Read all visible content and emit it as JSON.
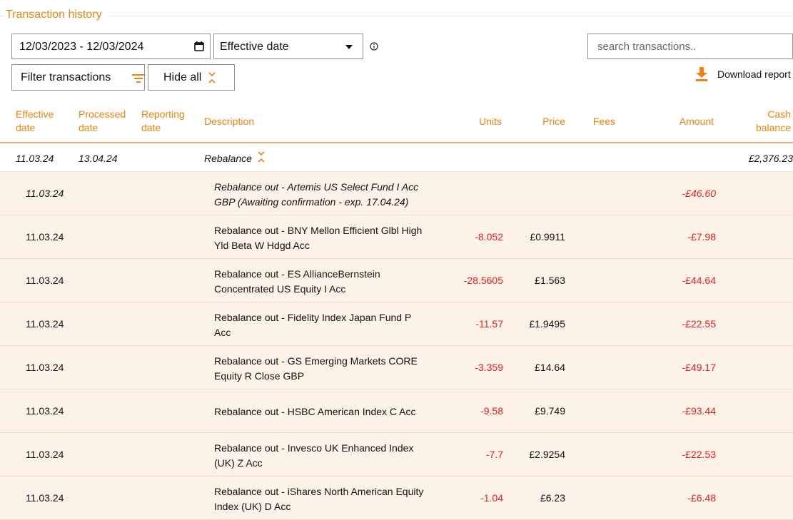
{
  "section": {
    "title": "Transaction history"
  },
  "filters": {
    "date_range": "12/03/2023 - 12/03/2024",
    "date_type": "Effective date",
    "search_placeholder": "search transactions..",
    "filter_label": "Filter transactions",
    "hide_label": "Hide all",
    "download_label": "Download report"
  },
  "colors": {
    "accent": "#f0820f",
    "negative": "#ee1c1c",
    "row_background": "#fdf2e8"
  },
  "icons": {
    "calendar": "calendar-icon",
    "dropdown": "caret-down-icon",
    "info": "info-icon",
    "filter": "filter-icon",
    "collapse": "chevrons-collapse-icon",
    "download": "download-icon"
  },
  "table": {
    "headers": {
      "effective_date": "Effective date",
      "processed_date": "Processed date",
      "reporting_date": "Reporting date",
      "description": "Description",
      "units": "Units",
      "price": "Price",
      "fees": "Fees",
      "amount": "Amount",
      "cash_balance": "Cash balance"
    },
    "group": {
      "effective_date": "11.03.24",
      "processed_date": "13.04.24",
      "description": "Rebalance",
      "cash_balance": "£2,376.23"
    },
    "rows": [
      {
        "effective_date": "11.03.24",
        "description": "Rebalance out - Artemis US Select Fund I Acc GBP (Awaiting confirmation - exp. 17.04.24)",
        "units": "",
        "price": "",
        "amount": "-£46.60",
        "pending": true
      },
      {
        "effective_date": "11.03.24",
        "description": "Rebalance out - BNY Mellon Efficient Glbl High Yld Beta W Hdgd Acc",
        "units": "-8.052",
        "price": "£0.9911",
        "amount": "-£7.98",
        "pending": false
      },
      {
        "effective_date": "11.03.24",
        "description": "Rebalance out - ES AllianceBernstein Concentrated US Equity I Acc",
        "units": "-28.5605",
        "price": "£1.563",
        "amount": "-£44.64",
        "pending": false
      },
      {
        "effective_date": "11.03.24",
        "description": "Rebalance out - Fidelity Index Japan Fund P Acc",
        "units": "-11.57",
        "price": "£1.9495",
        "amount": "-£22.55",
        "pending": false
      },
      {
        "effective_date": "11.03.24",
        "description": "Rebalance out - GS Emerging Markets CORE Equity R Close GBP",
        "units": "-3.359",
        "price": "£14.64",
        "amount": "-£49.17",
        "pending": false
      },
      {
        "effective_date": "11.03.24",
        "description": "Rebalance out - HSBC American Index C Acc",
        "units": "-9.58",
        "price": "£9.749",
        "amount": "-£93.44",
        "pending": false
      },
      {
        "effective_date": "11.03.24",
        "description": "Rebalance out - Invesco UK Enhanced Index (UK) Z Acc",
        "units": "-7.7",
        "price": "£2.9254",
        "amount": "-£22.53",
        "pending": false
      },
      {
        "effective_date": "11.03.24",
        "description": "Rebalance out - iShares North American Equity Index (UK) D Acc",
        "units": "-1.04",
        "price": "£6.23",
        "amount": "-£6.48",
        "pending": false
      }
    ]
  }
}
